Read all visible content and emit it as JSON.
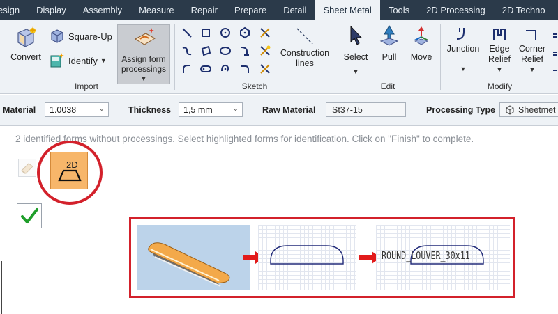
{
  "tabs": [
    {
      "label": "esign"
    },
    {
      "label": "Display"
    },
    {
      "label": "Assembly"
    },
    {
      "label": "Measure"
    },
    {
      "label": "Repair"
    },
    {
      "label": "Prepare"
    },
    {
      "label": "Detail"
    },
    {
      "label": "Sheet Metal",
      "active": true
    },
    {
      "label": "Tools"
    },
    {
      "label": "2D Processing"
    },
    {
      "label": "2D Techno"
    }
  ],
  "ribbon": {
    "import": {
      "convert": "Convert",
      "square_up": "Square-Up",
      "identify": "Identify",
      "assign_form_processings": "Assign form processings",
      "label": "Import"
    },
    "sketch": {
      "construction_lines": "Construction lines",
      "label": "Sketch",
      "tool_icons": [
        "line-icon",
        "rectangle-icon",
        "circle-icon",
        "polygon-icon",
        "trim-icon",
        "spline-icon",
        "rectangle3pt-icon",
        "ellipse-icon",
        "arc-icon",
        "offset-icon",
        "arc-tangent-icon",
        "slot-icon",
        "arc3pt-icon",
        "fillet-icon",
        "split-icon"
      ]
    },
    "edit": {
      "select": "Select",
      "pull": "Pull",
      "move": "Move",
      "label": "Edit"
    },
    "modify": {
      "junction": "Junction",
      "edge_relief": "Edge Relief",
      "corner_relief": "Corner Relief",
      "label": "Modify"
    }
  },
  "properties": {
    "material_label": "Material",
    "material_value": "1.0038",
    "thickness_label": "Thickness",
    "thickness_value": "1,5 mm",
    "raw_material_label": "Raw Material",
    "raw_material_value": "St37-15",
    "processing_type_label": "Processing Type",
    "processing_type_value": "Sheetmet"
  },
  "content": {
    "instruction": "2 identified forms without processings. Select highlighted forms for identification. Click on \"Finish\" to complete.",
    "form_icon_label": "2D",
    "illustration_label": "ROUND_LOUVER_30x11"
  },
  "colors": {
    "tab_bar": "#2b3a4a",
    "ribbon_bg": "#eef2f6",
    "highlight_red": "#d3212b",
    "form_orange": "#f7b66a",
    "check_green": "#1f9e2a"
  }
}
